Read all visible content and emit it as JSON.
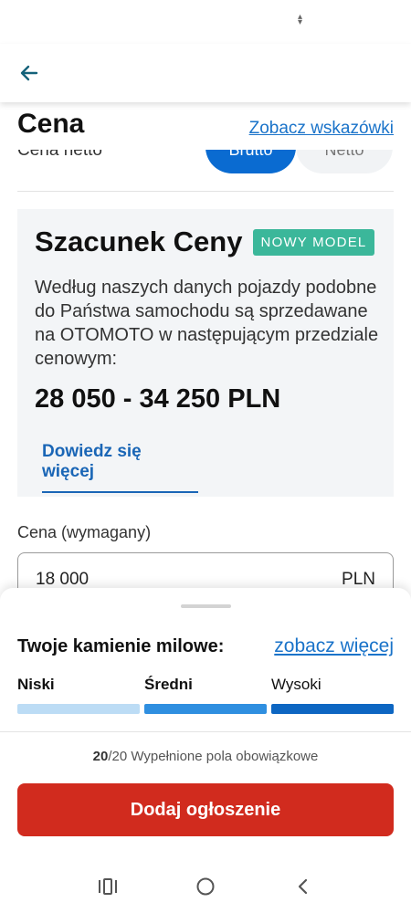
{
  "header": {
    "section_title": "Cena",
    "hint_link": "Zobacz wskazówki"
  },
  "vat_toggle": {
    "label": "Cena netto",
    "options": [
      "Brutto",
      "Netto"
    ],
    "selected": "Brutto"
  },
  "estimate": {
    "title": "Szacunek Ceny",
    "badge": "NOWY MODEL",
    "description": "Według naszych danych pojazdy podobne do Państwa samochodu są sprzedawane na OTOMOTO w następującym przedziale cenowym:",
    "price_range": "28 050 - 34 250 PLN",
    "learn_more": "Dowiedz się więcej"
  },
  "price_field": {
    "label": "Cena (wymagany)",
    "value": "18 000",
    "unit": "PLN"
  },
  "milestones": {
    "title": "Twoje kamienie milowe:",
    "link": "zobacz więcej",
    "levels": [
      {
        "label": "Niski",
        "color": "#bcdcf5"
      },
      {
        "label": "Średni",
        "color": "#2f8fe0"
      },
      {
        "label": "Wysoki",
        "color": "#0d66c2"
      }
    ]
  },
  "required": {
    "filled": "20",
    "total": "/20",
    "text": "Wypełnione pola obowiązkowe"
  },
  "submit": {
    "label": "Dodaj ogłoszenie"
  },
  "colors": {
    "primary_blue": "#0a6bd1",
    "link_blue": "#1a73c9",
    "badge_green": "#3bb79a",
    "submit_red": "#d12b1e"
  }
}
